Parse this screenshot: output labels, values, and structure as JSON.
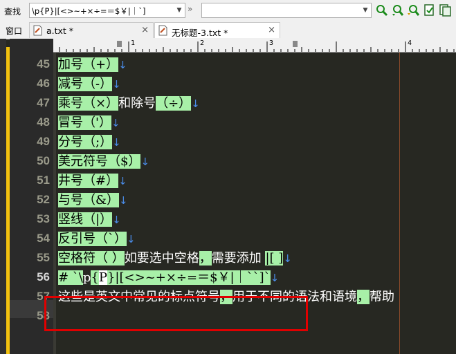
{
  "toolbar": {
    "find_label": "查找",
    "find_value": "\\p{P}|[<>~+×÷=＝$￥|｜`]",
    "replace_value": "",
    "dbl_arrow": "»"
  },
  "tabs": {
    "window_label": "窗口",
    "items": [
      {
        "title": "a.txt *",
        "close": "×",
        "active": false
      },
      {
        "title": "无标题-3.txt *",
        "close": "×",
        "active": true
      }
    ]
  },
  "ruler": {
    "ticks": [
      "1",
      "2",
      "3",
      "4"
    ]
  },
  "lines": [
    {
      "num": "45",
      "segs": [
        [
          "h",
          "加号（+）"
        ],
        [
          "a",
          "↓"
        ]
      ]
    },
    {
      "num": "46",
      "segs": [
        [
          "h",
          "减号（-）"
        ],
        [
          "a",
          "↓"
        ]
      ]
    },
    {
      "num": "47",
      "segs": [
        [
          "h",
          "乘号（×）"
        ],
        [
          "p",
          "和除号"
        ],
        [
          "h",
          "（÷）"
        ],
        [
          "a",
          "↓"
        ]
      ]
    },
    {
      "num": "48",
      "segs": [
        [
          "h",
          "冒号（'）"
        ],
        [
          "a",
          "↓"
        ]
      ]
    },
    {
      "num": "49",
      "segs": [
        [
          "h",
          "分号（;）"
        ],
        [
          "a",
          "↓"
        ]
      ]
    },
    {
      "num": "50",
      "segs": [
        [
          "h",
          "美元符号（$）"
        ],
        [
          "a",
          "↓"
        ]
      ]
    },
    {
      "num": "51",
      "segs": [
        [
          "h",
          "井号（#）"
        ],
        [
          "a",
          "↓"
        ]
      ]
    },
    {
      "num": "52",
      "segs": [
        [
          "h",
          "与号（&）"
        ],
        [
          "a",
          "↓"
        ]
      ]
    },
    {
      "num": "53",
      "segs": [
        [
          "h",
          "竖线（|）"
        ],
        [
          "a",
          "↓"
        ]
      ]
    },
    {
      "num": "54",
      "segs": [
        [
          "h",
          "反引号（`）"
        ],
        [
          "a",
          "↓"
        ]
      ]
    },
    {
      "num": "55",
      "segs": [
        [
          "h",
          "空格符（ ）"
        ],
        [
          "p",
          "如要选中空格"
        ],
        [
          "h",
          "，"
        ],
        [
          "p",
          "需要添加 "
        ],
        [
          "h",
          "|[ ]"
        ],
        [
          "a",
          "↓"
        ]
      ]
    },
    {
      "num": "56",
      "segs": [
        [
          "h",
          "# `\\"
        ],
        [
          "p",
          "p"
        ],
        [
          "h",
          "{"
        ],
        [
          "s",
          "P"
        ],
        [
          "h",
          "}|[<>~+×÷=＝$￥|｜``]`"
        ],
        [
          "a",
          "↓"
        ]
      ]
    },
    {
      "num": "57",
      "segs": [
        [
          "p",
          "这些是英文中常见的标点符号"
        ],
        [
          "h",
          "，"
        ],
        [
          "p",
          "用于不同的语法和语境"
        ],
        [
          "h",
          "，"
        ],
        [
          "p",
          "帮助"
        ]
      ]
    },
    {
      "num": "58",
      "segs": []
    }
  ]
}
